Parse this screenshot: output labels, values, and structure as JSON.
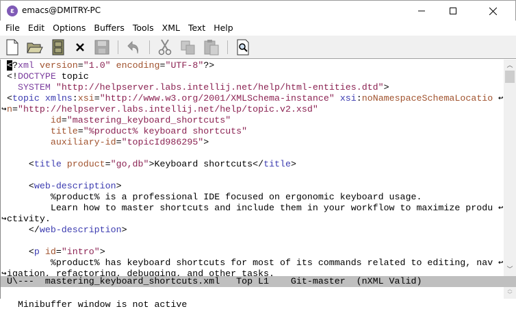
{
  "window": {
    "title": "emacs@DMITRY-PC",
    "icon": "emacs-icon",
    "minimize": "–",
    "maximize": "☐",
    "close": "✕"
  },
  "menubar": [
    "File",
    "Edit",
    "Options",
    "Buffers",
    "Tools",
    "XML",
    "Text",
    "Help"
  ],
  "toolbar": [
    "new-file-icon",
    "open-folder-icon",
    "dired-cabinet-icon",
    "close-buffer-icon",
    "save-icon",
    "undo-icon",
    "cut-icon",
    "copy-icon",
    "paste-icon",
    "search-icon"
  ],
  "editor": {
    "lines": [
      [
        [
          "d",
          "<?"
        ],
        [
          "k",
          "xml"
        ],
        [
          "x",
          " "
        ],
        [
          "a",
          "version"
        ],
        [
          "d",
          "="
        ],
        [
          "s",
          "\"1.0\""
        ],
        [
          "x",
          " "
        ],
        [
          "a",
          "encoding"
        ],
        [
          "d",
          "="
        ],
        [
          "s",
          "\"UTF-8\""
        ],
        [
          "d",
          "?>"
        ]
      ],
      [
        [
          "d",
          "<!"
        ],
        [
          "k",
          "DOCTYPE"
        ],
        [
          "x",
          " topic"
        ]
      ],
      [
        [
          "x",
          "  "
        ],
        [
          "k",
          "SYSTEM"
        ],
        [
          "x",
          " "
        ],
        [
          "s",
          "\"http://helpserver.labs.intellij.net/help/html-entities.dtd\""
        ],
        [
          "d",
          ">"
        ]
      ],
      [
        [
          "d",
          "<"
        ],
        [
          "t",
          "topic"
        ],
        [
          "x",
          " "
        ],
        [
          "t",
          "xmlns"
        ],
        [
          "d",
          ":"
        ],
        [
          "a",
          "xsi"
        ],
        [
          "d",
          "="
        ],
        [
          "s",
          "\"http://www.w3.org/2001/XMLSchema-instance\""
        ],
        [
          "x",
          " "
        ],
        [
          "t",
          "xsi"
        ],
        [
          "d",
          ":"
        ],
        [
          "a",
          "noNamespaceSchemaLocatio"
        ]
      ],
      [
        [
          "a",
          "n"
        ],
        [
          "d",
          "="
        ],
        [
          "s",
          "\"http://helpserver.labs.intellij.net/help/topic.v2.xsd\""
        ]
      ],
      [
        [
          "x",
          "        "
        ],
        [
          "a",
          "id"
        ],
        [
          "d",
          "="
        ],
        [
          "s",
          "\"mastering_keyboard_shortcuts\""
        ]
      ],
      [
        [
          "x",
          "        "
        ],
        [
          "a",
          "title"
        ],
        [
          "d",
          "="
        ],
        [
          "s",
          "\"%product% keyboard shortcuts\""
        ]
      ],
      [
        [
          "x",
          "        "
        ],
        [
          "a",
          "auxiliary-id"
        ],
        [
          "d",
          "="
        ],
        [
          "s",
          "\"topicId986295\""
        ],
        [
          "d",
          ">"
        ]
      ],
      [],
      [
        [
          "x",
          "    "
        ],
        [
          "d",
          "<"
        ],
        [
          "t",
          "title"
        ],
        [
          "x",
          " "
        ],
        [
          "a",
          "product"
        ],
        [
          "d",
          "="
        ],
        [
          "s",
          "\"go,db\""
        ],
        [
          "d",
          ">"
        ],
        [
          "x",
          "Keyboard shortcuts"
        ],
        [
          "d",
          "</"
        ],
        [
          "t",
          "title"
        ],
        [
          "d",
          ">"
        ]
      ],
      [],
      [
        [
          "x",
          "    "
        ],
        [
          "d",
          "<"
        ],
        [
          "t",
          "web-description"
        ],
        [
          "d",
          ">"
        ]
      ],
      [
        [
          "x",
          "        %product% is a professional IDE focused on ergonomic keyboard usage."
        ]
      ],
      [
        [
          "x",
          "        Learn how to master shortcuts and include them in your workflow to maximize produ"
        ]
      ],
      [
        [
          "x",
          "ctivity."
        ]
      ],
      [
        [
          "x",
          "    "
        ],
        [
          "d",
          "</"
        ],
        [
          "t",
          "web-description"
        ],
        [
          "d",
          ">"
        ]
      ],
      [],
      [
        [
          "x",
          "    "
        ],
        [
          "d",
          "<"
        ],
        [
          "t",
          "p"
        ],
        [
          "x",
          " "
        ],
        [
          "a",
          "id"
        ],
        [
          "d",
          "="
        ],
        [
          "s",
          "\"intro\""
        ],
        [
          "d",
          ">"
        ]
      ],
      [
        [
          "x",
          "        %product% has keyboard shortcuts for most of its commands related to editing, nav"
        ]
      ],
      [
        [
          "x",
          "igation, refactoring, debugging, and other tasks."
        ]
      ]
    ],
    "wrapped_lines": [
      3,
      13,
      18
    ]
  },
  "modeline": "U\\---  mastering_keyboard_shortcuts.xml   Top L1    Git-master  (nXML Valid)",
  "minibuffer": "Minibuffer window is not active"
}
